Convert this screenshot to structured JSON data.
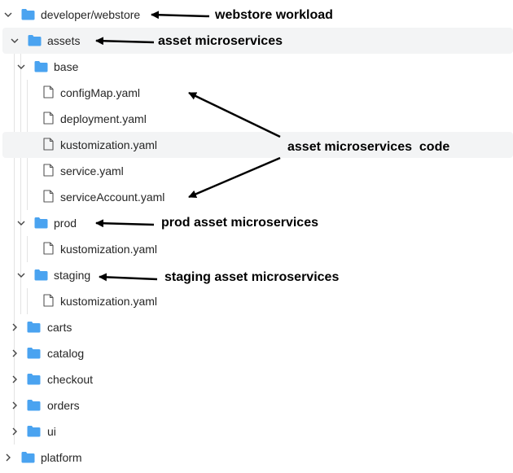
{
  "tree": {
    "root_label": "developer/webstore",
    "assets_label": "assets",
    "base_label": "base",
    "base_files": [
      "configMap.yaml",
      "deployment.yaml",
      "kustomization.yaml",
      "service.yaml",
      "serviceAccount.yaml"
    ],
    "prod_label": "prod",
    "prod_file": "kustomization.yaml",
    "staging_label": "staging",
    "staging_file": "kustomization.yaml",
    "collapsed_folders": [
      "carts",
      "catalog",
      "checkout",
      "orders",
      "ui"
    ],
    "platform_label": "platform"
  },
  "annotations": {
    "webstore": "webstore workload",
    "assets": "asset microservices",
    "code": "asset microservices  code",
    "prod": "prod asset microservices",
    "staging": "staging asset microservices"
  },
  "colors": {
    "folder": "#4aa3f0",
    "highlight": "#f3f4f5",
    "chevron": "#444444",
    "arrow": "#000000"
  },
  "icons": {
    "folder": "folder-icon",
    "file": "file-icon",
    "expanded": "chevron-down-icon",
    "collapsed": "chevron-right-icon"
  }
}
